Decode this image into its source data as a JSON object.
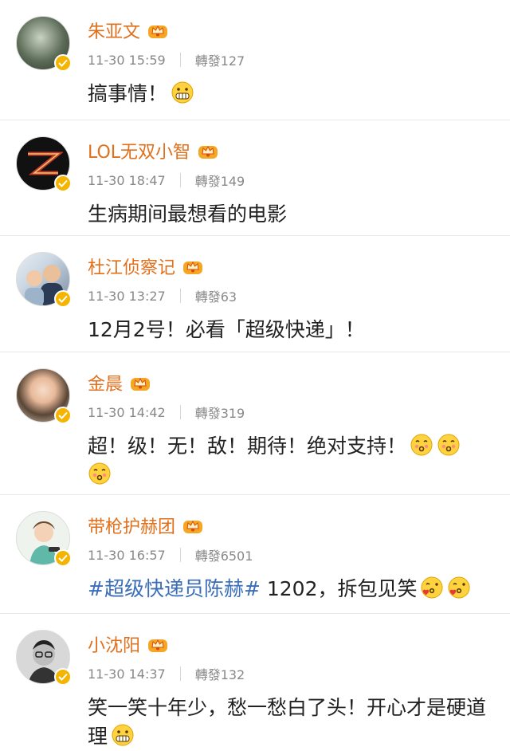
{
  "posts": [
    {
      "name": "朱亚文",
      "time": "11-30 15:59",
      "repost": "轉發127",
      "text": "搞事情！",
      "emojis": [
        "grin"
      ]
    },
    {
      "name": "LOL无双小智",
      "time": "11-30 18:47",
      "repost": "轉發149",
      "text": "生病期间最想看的电影",
      "emojis": []
    },
    {
      "name": "杜江侦察记",
      "time": "11-30 13:27",
      "repost": "轉發63",
      "text": "12月2号！必看「超级快递」！",
      "emojis": []
    },
    {
      "name": "金晨",
      "time": "11-30 14:42",
      "repost": "轉發319",
      "text": "超！级！无！敌！期待！绝对支持！",
      "emojis": [
        "kiss",
        "kiss",
        "kiss"
      ]
    },
    {
      "name": "带枪护赫团",
      "time": "11-30 16:57",
      "repost": "轉發6501",
      "hashtag": "#超级快递员陈赫#",
      "text": " 1202，拆包见笑",
      "emojis": [
        "kiss-heart",
        "kiss-heart"
      ]
    },
    {
      "name": "小沈阳",
      "time": "11-30 14:37",
      "repost": "轉發132",
      "text": "笑一笑十年少，愁一愁白了头！开心才是硬道理",
      "emojis": [
        "grin"
      ]
    }
  ],
  "colors": {
    "name": "#e0701c",
    "meta": "#888888",
    "hashtag": "#3b6eb8",
    "badge": "#f4b400"
  }
}
